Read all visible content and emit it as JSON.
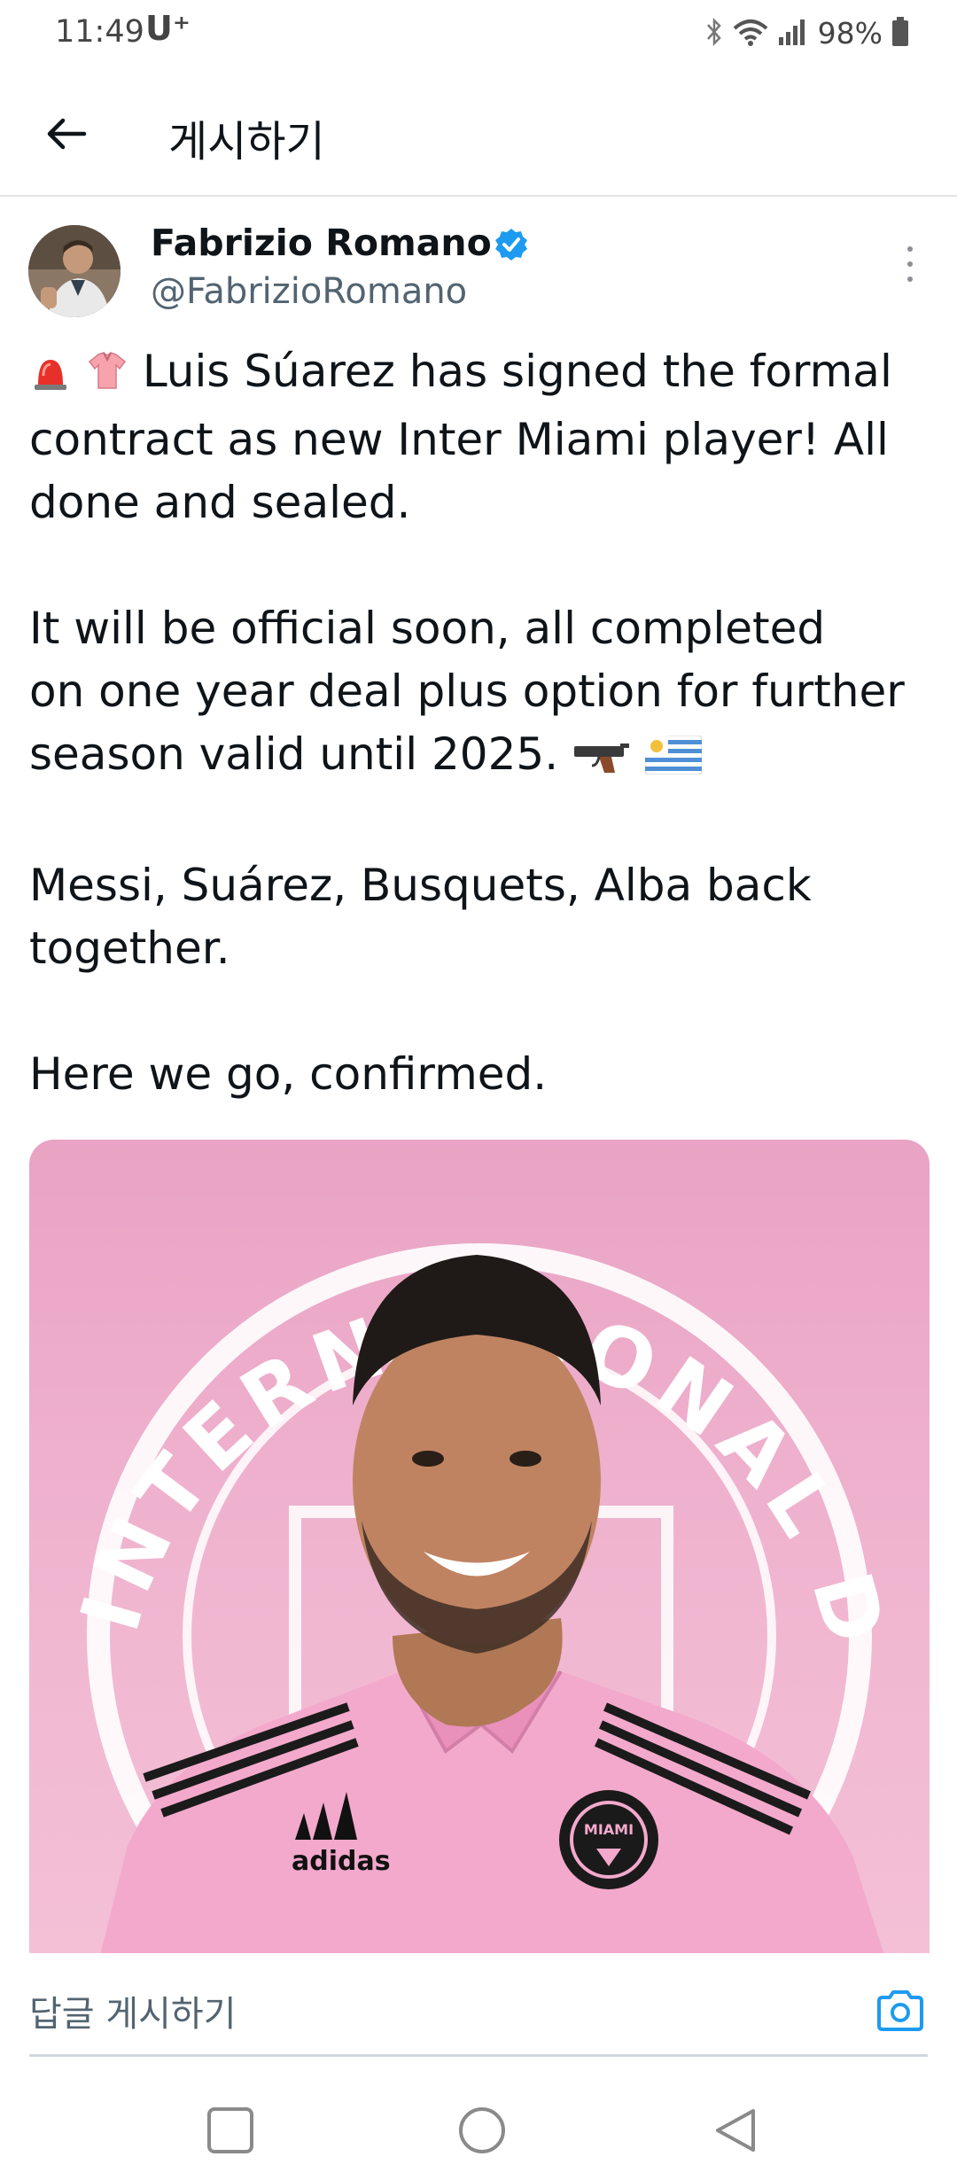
{
  "status_bar": {
    "time": "11:49",
    "carrier": "U⁺",
    "battery_percent": "98%"
  },
  "header": {
    "title": "게시하기"
  },
  "tweet": {
    "author_name": "Fabrizio Romano",
    "author_handle": "@FabrizioRomano",
    "paragraphs": [
      {
        "lines": [
          "Luis Súarez has signed the formal",
          "contract as new Inter Miami player! All",
          "done and sealed."
        ]
      },
      {
        "lines": [
          "It will be official soon, all completed",
          "on one year deal plus option for further",
          "season valid until 2025."
        ]
      },
      {
        "lines": [
          "Messi, Suárez, Busquets, Alba back",
          "together."
        ]
      },
      {
        "lines": [
          "Here we go, confirmed."
        ]
      }
    ],
    "image_alt": "Luis Suárez in pink Inter Miami shirt in front of Inter Miami crest",
    "image_crest_text": "INTERNACIONAL DE FÚTBOL",
    "shirt_brand": "adidas",
    "badge_text": "MIAMI"
  },
  "reply": {
    "placeholder": "답글 게시하기"
  },
  "colors": {
    "verified": "#1d9bf0",
    "accent": "#1d9bf0",
    "image_pink": "#f1b7d1"
  },
  "icons": {
    "back": "arrow-left-icon",
    "verified": "verified-badge-icon",
    "more": "more-vertical-icon",
    "camera": "camera-icon",
    "nav_recent": "square-icon",
    "nav_home": "circle-icon",
    "nav_back": "triangle-back-icon"
  }
}
